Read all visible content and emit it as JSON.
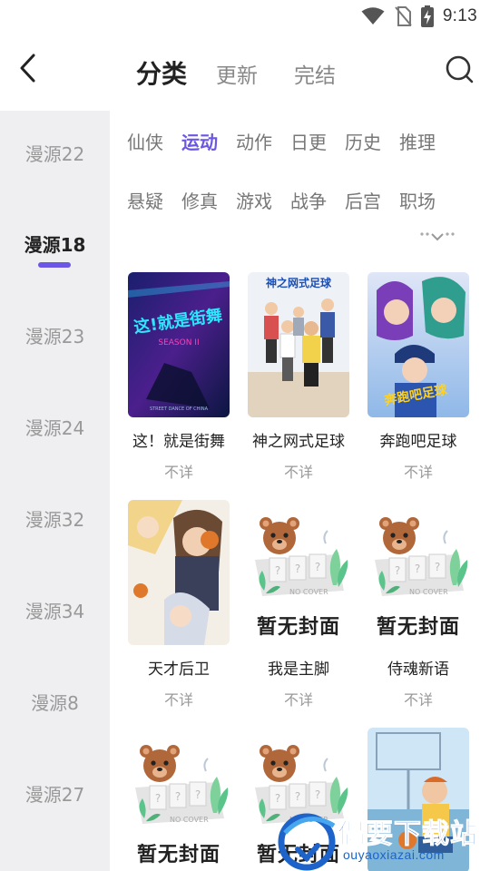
{
  "status_bar": {
    "time": "9:13",
    "icons": [
      "wifi-icon",
      "no-sim-icon",
      "battery-charging-icon"
    ]
  },
  "header": {
    "back_icon": "chevron-left-icon",
    "tabs": [
      {
        "label": "分类",
        "active": true
      },
      {
        "label": "更新",
        "active": false
      },
      {
        "label": "完结",
        "active": false
      }
    ],
    "search_icon": "search-icon"
  },
  "sidebar": {
    "items": [
      {
        "label": "漫源22",
        "active": false
      },
      {
        "label": "漫源18",
        "active": true
      },
      {
        "label": "漫源23",
        "active": false
      },
      {
        "label": "漫源24",
        "active": false
      },
      {
        "label": "漫源32",
        "active": false
      },
      {
        "label": "漫源34",
        "active": false
      },
      {
        "label": "漫源8",
        "active": false
      },
      {
        "label": "漫源27",
        "active": false
      }
    ]
  },
  "categories": {
    "row1": [
      "仙侠",
      "运动",
      "动作",
      "日更",
      "历史",
      "推理"
    ],
    "row2": [
      "悬疑",
      "修真",
      "游戏",
      "战争",
      "后宫",
      "职场"
    ],
    "active": "运动",
    "expand_icon": "chevron-down-icon"
  },
  "comics": [
    {
      "title": "这！就是街舞",
      "status": "不详",
      "cover": "street-dance-cover",
      "cover_text": "这!就是街舞"
    },
    {
      "title": "神之网式足球",
      "status": "不详",
      "cover": "tennis-football-cover",
      "cover_text": "神之网式足球"
    },
    {
      "title": "奔跑吧足球",
      "status": "不详",
      "cover": "run-football-cover",
      "cover_text": "奔跑吧足球"
    },
    {
      "title": "天才后卫",
      "status": "不详",
      "cover": "basketball-cover",
      "cover_text": ""
    },
    {
      "title": "我是主脚",
      "status": "不详",
      "cover": "no-cover",
      "cover_text": "暂无封面"
    },
    {
      "title": "侍魂新语",
      "status": "不详",
      "cover": "no-cover",
      "cover_text": "暂无封面"
    },
    {
      "title": "",
      "status": "",
      "cover": "no-cover",
      "cover_text": "暂无封面"
    },
    {
      "title": "",
      "status": "",
      "cover": "no-cover",
      "cover_text": "暂无封面"
    },
    {
      "title": "",
      "status": "",
      "cover": "basketball-court-cover",
      "cover_text": ""
    }
  ],
  "no_cover_label": "NO COVER",
  "watermark": {
    "title": "偶要下载站",
    "url": "ouyaoxiazai.com"
  },
  "colors": {
    "accent": "#6b56e6",
    "sidebar_bg": "#efeff1",
    "watermark_blue": "#1d63c9"
  }
}
